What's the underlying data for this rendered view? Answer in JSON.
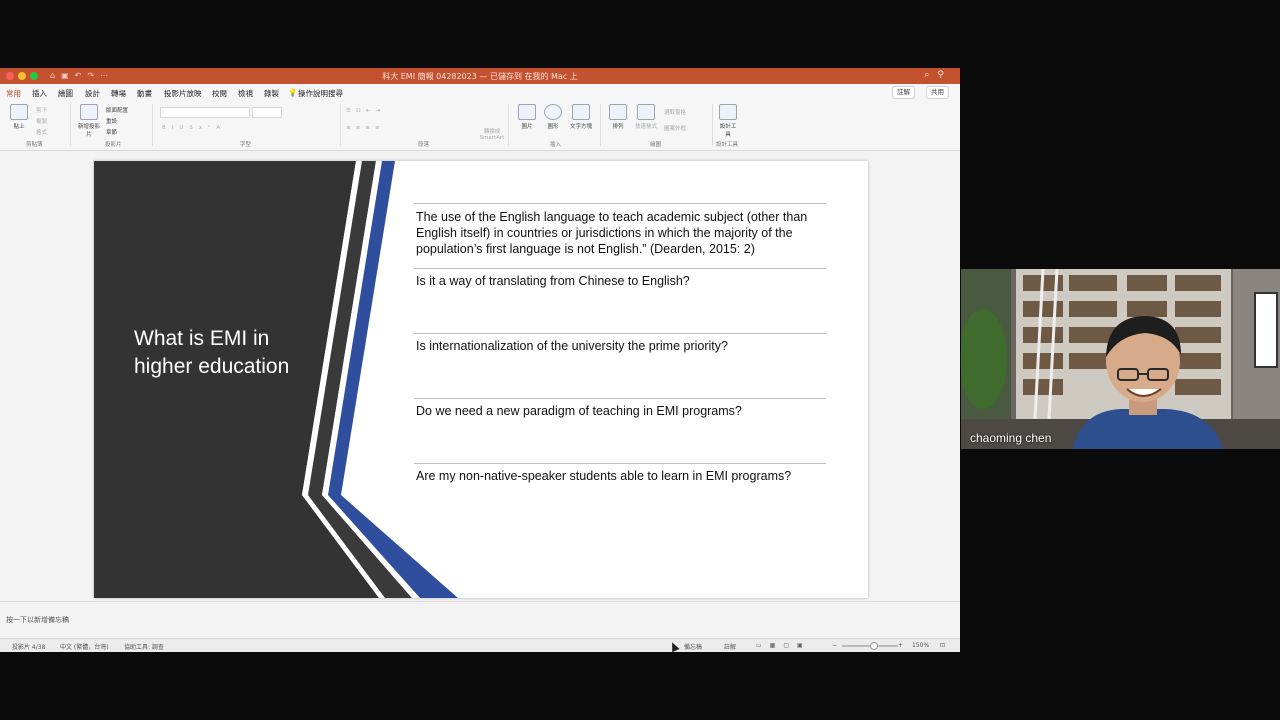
{
  "window": {
    "title": "科大 EMI 簡報 04282023 — 已儲存到 在我的 Mac 上",
    "colors": {
      "titlebar": "#c4512f",
      "accent": "#b64a2b"
    }
  },
  "ribbon": {
    "tabs": [
      "常用",
      "插入",
      "繪圖",
      "設計",
      "轉場",
      "動畫",
      "投影片放映",
      "校閱",
      "檢視",
      "錄製"
    ],
    "active_tab": "常用",
    "tell_me": "操作說明搜尋",
    "comments_label": "註解",
    "share_label": "共用",
    "clipboard": {
      "paste": "貼上",
      "cut": "剪下",
      "copy": "複製",
      "format": "格式",
      "group": "剪貼簿"
    },
    "slides": {
      "new_slide": "新增投影片",
      "layout": "版面配置",
      "reset": "重設",
      "section": "章節",
      "group": "投影片"
    },
    "font_group": "字型",
    "paragraph": {
      "smartart": "轉換成 SmartArt",
      "group": "段落"
    },
    "insert": {
      "picture": "圖片",
      "shapes": "圖形",
      "textbox": "文字方塊",
      "group": "插入"
    },
    "drawing": {
      "arrange": "排列",
      "quick_styles": "快速樣式",
      "select_shape": "選取窗格",
      "shape_outline": "圖案外框",
      "group": "繪圖"
    },
    "designer": {
      "label": "設計工具",
      "group": "設計工具"
    }
  },
  "slide": {
    "title": "What is EMI in higher education",
    "bullets": [
      "The use of the English language to teach academic subject (other than English itself) in countries or jurisdictions in which the majority of the population’s first language is not English.” (Dearden, 2015: 2)",
      "Is it a way of translating from Chinese to English?",
      "Is internationalization of the university the prime priority?",
      "Do we need a new paradigm of teaching in EMI programs?",
      "Are my non-native-speaker students able to learn in EMI programs?"
    ],
    "colors": {
      "dark_panel": "#333333",
      "blue_stripe": "#2f4f9e",
      "gray_stripe": "#5a5a5a"
    }
  },
  "notes": {
    "placeholder": "按一下以新增備忘稿"
  },
  "status": {
    "slide_counter": "投影片 4/38",
    "language": "中文 (繁體，台灣)",
    "accessibility": "協助工具: 調查",
    "notes_btn": "備忘稿",
    "comments_btn": "註解",
    "zoom": "150%"
  },
  "webcam": {
    "participant_name": "chaoming chen"
  }
}
